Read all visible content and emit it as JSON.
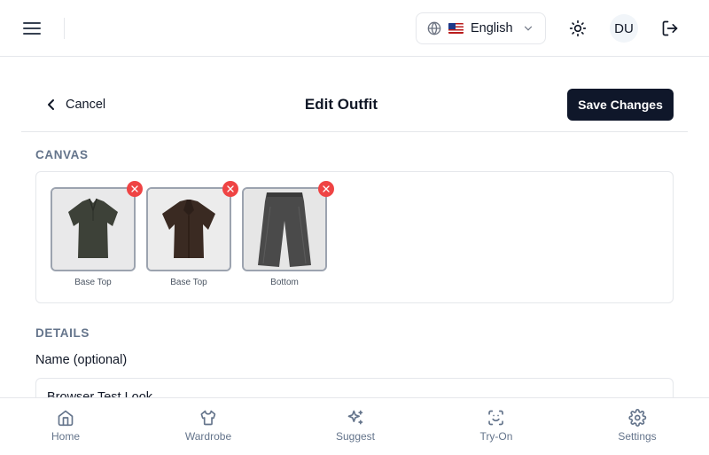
{
  "header": {
    "language": {
      "flag": "us-flag-icon",
      "label": "English"
    },
    "user_initials": "DU"
  },
  "page": {
    "cancel_label": "Cancel",
    "title": "Edit Outfit",
    "save_label": "Save Changes"
  },
  "canvas": {
    "section_label": "CANVAS",
    "items": [
      {
        "label": "Base Top",
        "image": "green-polo-shirt"
      },
      {
        "label": "Base Top",
        "image": "brown-short-sleeve-shirt"
      },
      {
        "label": "Bottom",
        "image": "grey-wide-leg-jeans"
      }
    ]
  },
  "details": {
    "section_label": "DETAILS",
    "name_label": "Name (optional)",
    "name_value": "Browser Test Look"
  },
  "bottom_nav": [
    {
      "label": "Home",
      "icon": "home-icon"
    },
    {
      "label": "Wardrobe",
      "icon": "shirt-icon"
    },
    {
      "label": "Suggest",
      "icon": "sparkles-icon"
    },
    {
      "label": "Try-On",
      "icon": "scan-face-icon"
    },
    {
      "label": "Settings",
      "icon": "gear-icon"
    }
  ],
  "colors": {
    "primary": "#0f172a",
    "remove": "#ef4444",
    "muted": "#64748b",
    "border": "#e5e7eb"
  }
}
